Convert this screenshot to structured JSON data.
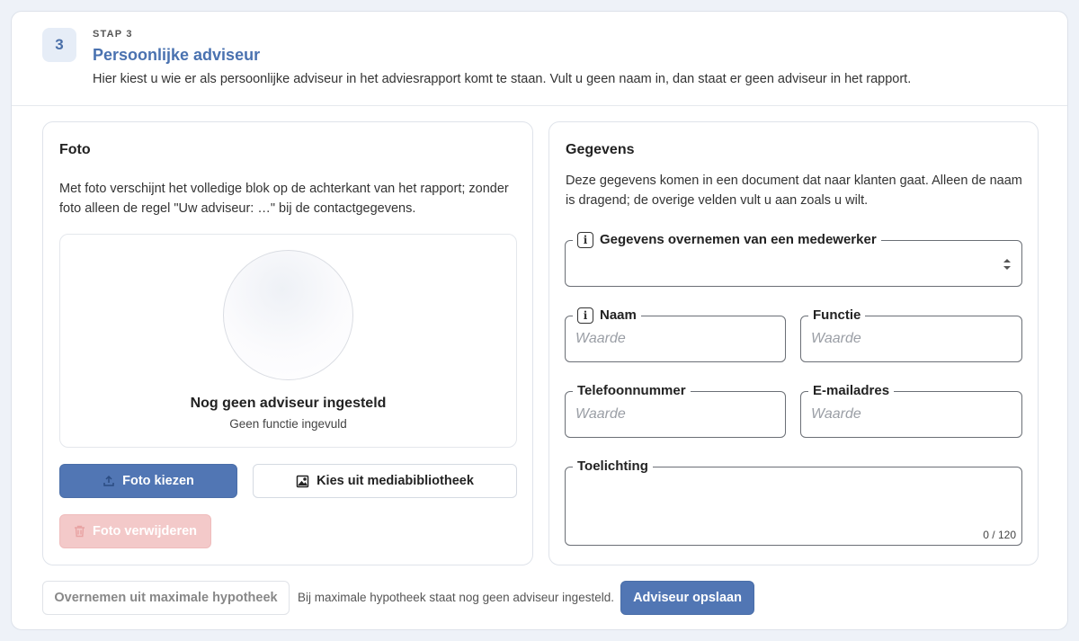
{
  "step": {
    "number": "3",
    "label": "STAP 3",
    "title": "Persoonlijke adviseur",
    "description": "Hier kiest u wie er als persoonlijke adviseur in het adviesrapport komt te staan. Vult u geen naam in, dan staat er geen adviseur in het rapport."
  },
  "photo_panel": {
    "title": "Foto",
    "description": "Met foto verschijnt het volledige blok op de achterkant van het rapport; zonder foto alleen de regel \"Uw adviseur: …\" bij de contactgegevens.",
    "preview_name": "Nog geen adviseur ingesteld",
    "preview_function": "Geen functie ingevuld",
    "choose_label": "Foto kiezen",
    "media_label": "Kies uit mediabibliotheek",
    "remove_label": "Foto verwijderen"
  },
  "details_panel": {
    "title": "Gegevens",
    "description": "Deze gegevens komen in een document dat naar klanten gaat. Alleen de naam is dragend; de overige velden vult u aan zoals u wilt.",
    "employee_label": "Gegevens overnemen van een medewerker",
    "employee_value": "",
    "name_label": "Naam",
    "name_placeholder": "Waarde",
    "function_label": "Functie",
    "function_placeholder": "Waarde",
    "phone_label": "Telefoonnummer",
    "phone_placeholder": "Waarde",
    "email_label": "E-mailadres",
    "email_placeholder": "Waarde",
    "note_label": "Toelichting",
    "note_counter": "0 / 120"
  },
  "footer": {
    "takeover_label": "Overnemen uit maximale hypotheek",
    "note": "Bij maximale hypotheek staat nog geen adviseur ingesteld.",
    "save_label": "Adviseur opslaan"
  },
  "colors": {
    "accent": "#5176b4",
    "danger_disabled": "#f3c9c9"
  },
  "icons": {
    "choose": "upload-icon",
    "media": "image-icon",
    "remove": "trash-icon",
    "info": "info-icon",
    "select": "select-arrows-icon"
  }
}
